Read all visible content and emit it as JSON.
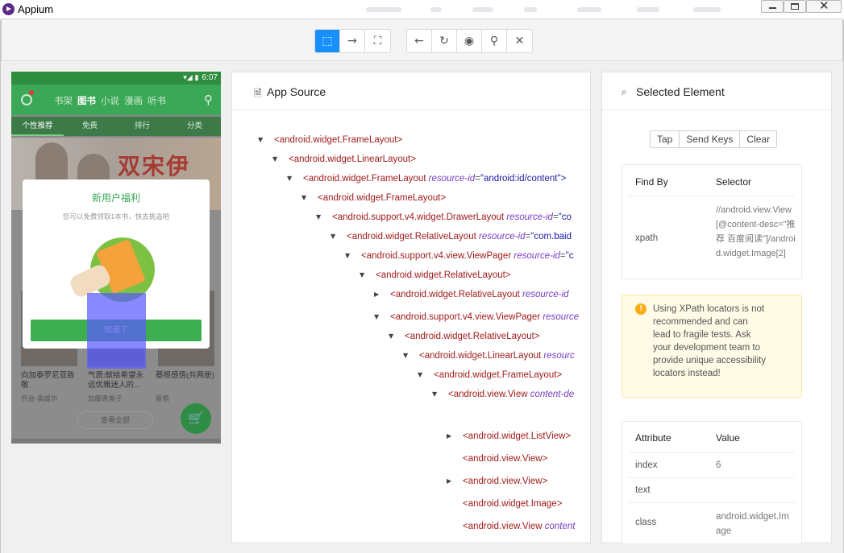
{
  "window": {
    "title": "Appium"
  },
  "device": {
    "status_time": "6:07",
    "status_icons": "▾◢ ▮",
    "nav": [
      "书架",
      "图书",
      "小说",
      "漫画",
      "听书"
    ],
    "tabs": [
      "个性推荐",
      "免费",
      "排行",
      "分类"
    ],
    "banner_text": "双宋伊",
    "popup": {
      "title": "新用户福利",
      "subtitle": "您可以免费领取1本书，快去挑选吧",
      "button": "知道了"
    },
    "books": [
      {
        "title": "向加泰罗尼亚致敬",
        "author": "乔治·奥威尔"
      },
      {
        "title": "气质:献给希望永远优雅迷人的...",
        "author": "加藤惠美子"
      },
      {
        "title": "蔡根感悟(共两册)",
        "author": "蔡根"
      }
    ],
    "view_all": "查看全部",
    "cart_icon": "shopping-cart-icon"
  },
  "app_source": {
    "title": "App Source",
    "icon": "file-icon",
    "nodes": [
      {
        "indent": 0,
        "arrow": "▼",
        "tag": "android.widget.FrameLayout",
        "attr": "",
        "val": ""
      },
      {
        "indent": 1,
        "arrow": "▼",
        "tag": "android.widget.LinearLayout",
        "attr": "",
        "val": ""
      },
      {
        "indent": 2,
        "arrow": "▼",
        "tag": "android.widget.FrameLayout",
        "attr": "resource-id",
        "val": "\"android:id/content\">"
      },
      {
        "indent": 3,
        "arrow": "▼",
        "tag": "android.widget.FrameLayout",
        "attr": "",
        "val": ""
      },
      {
        "indent": 4,
        "arrow": "▼",
        "tag": "android.support.v4.widget.DrawerLayout",
        "attr": "resource-id",
        "val": "\"co"
      },
      {
        "indent": 5,
        "arrow": "▼",
        "tag": "android.widget.RelativeLayout",
        "attr": "resource-id",
        "val": "\"com.baid"
      },
      {
        "indent": 6,
        "arrow": "▼",
        "tag": "android.support.v4.view.ViewPager",
        "attr": "resource-id",
        "val": "\"c"
      },
      {
        "indent": 7,
        "arrow": "▼",
        "tag": "android.widget.RelativeLayout",
        "attr": "",
        "val": ""
      },
      {
        "indent": 8,
        "arrow": "▶",
        "tag": "android.widget.RelativeLayout",
        "attr": "resource-id",
        "val": ""
      },
      {
        "indent": 8,
        "arrow": "▼",
        "tag": "android.support.v4.view.ViewPager",
        "attr": "resource",
        "val": ""
      },
      {
        "indent": 9,
        "arrow": "▼",
        "tag": "android.widget.RelativeLayout",
        "attr": "",
        "val": ""
      },
      {
        "indent": 10,
        "arrow": "▼",
        "tag": "android.widget.LinearLayout",
        "attr": "resourc",
        "val": ""
      },
      {
        "indent": 11,
        "arrow": "▼",
        "tag": "android.widget.FrameLayout",
        "attr": "",
        "val": ""
      },
      {
        "indent": 12,
        "arrow": "▼",
        "tag": "android.view.View",
        "attr": "content-de",
        "val": ""
      },
      {
        "indent": 13,
        "arrow": "▶",
        "tag": "android.widget.ListView",
        "attr": "",
        "val": ""
      },
      {
        "indent": 13,
        "arrow": "",
        "tag": "android.view.View",
        "attr": "",
        "val": ""
      },
      {
        "indent": 13,
        "arrow": "▶",
        "tag": "android.view.View",
        "attr": "",
        "val": ""
      },
      {
        "indent": 13,
        "arrow": "",
        "tag": "android.widget.Image",
        "attr": "",
        "val": ""
      },
      {
        "indent": 13,
        "arrow": "",
        "tag": "android.view.View",
        "attr": "content",
        "val": ""
      },
      {
        "indent": 13,
        "arrow": "",
        "tag": "android.view.View",
        "attr": "content",
        "val": ""
      }
    ]
  },
  "selected": {
    "title": "Selected Element",
    "icon": "tag-icon",
    "actions": [
      "Tap",
      "Send Keys",
      "Clear"
    ],
    "find_by_header": "Find By",
    "selector_header": "Selector",
    "find_by": "xpath",
    "selector": "//android.view.View[@content-desc=\"推荐 百度阅读\"]/android.widget.Image[2]",
    "warning": "Using XPath locators is not recommended and can lead to fragile tests. Ask your development team to provide unique accessibility locators instead!",
    "attr_header": "Attribute",
    "value_header": "Value",
    "attributes": [
      {
        "name": "index",
        "value": "6"
      },
      {
        "name": "text",
        "value": ""
      },
      {
        "name": "class",
        "value": "android.widget.Image"
      }
    ]
  }
}
